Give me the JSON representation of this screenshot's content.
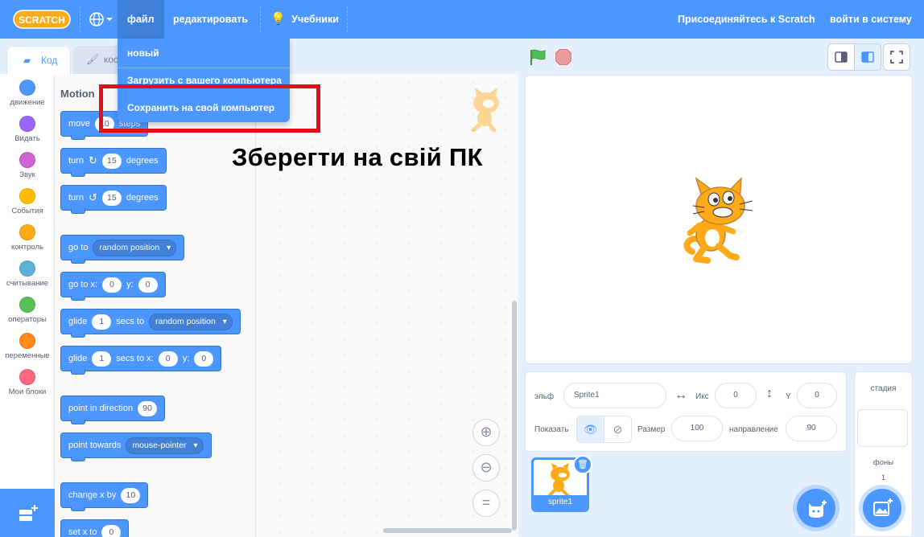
{
  "menubar": {
    "logo_text": "SCRATCH",
    "file": "файл",
    "edit": "редактировать",
    "tutorials": "Учебники",
    "join": "Присоединяйтесь к Scratch",
    "signin": "войти в систему"
  },
  "file_menu": {
    "items": [
      "новый",
      "Загрузить с вашего компьютера",
      "Сохранить на свой компьютер"
    ]
  },
  "annotation": "Зберегти на свій ПК",
  "tabs": {
    "code": "Код",
    "costumes": "кост"
  },
  "categories": [
    {
      "label": "движение",
      "color": "#4c97ff"
    },
    {
      "label": "Видать",
      "color": "#9966ff"
    },
    {
      "label": "Звук",
      "color": "#cf63cf"
    },
    {
      "label": "События",
      "color": "#ffbf00"
    },
    {
      "label": "контроль",
      "color": "#ffab19"
    },
    {
      "label": "считывание",
      "color": "#5cb1d6"
    },
    {
      "label": "операторы",
      "color": "#59c059"
    },
    {
      "label": "переменные",
      "color": "#ff8c1a"
    },
    {
      "label": "Мои блоки",
      "color": "#ff6680"
    }
  ],
  "palette": {
    "title": "Motion",
    "move": {
      "a": "move",
      "n": "10",
      "b": "steps"
    },
    "turn_right": {
      "a": "turn",
      "n": "15",
      "b": "degrees"
    },
    "turn_left": {
      "a": "turn",
      "n": "15",
      "b": "degrees"
    },
    "goto": {
      "a": "go to",
      "d": "random position"
    },
    "gotoxy": {
      "a": "go to x:",
      "x": "0",
      "b": "y:",
      "y": "0"
    },
    "glide_to": {
      "a": "glide",
      "n": "1",
      "b": "secs to",
      "d": "random position"
    },
    "glide_xy": {
      "a": "glide",
      "n": "1",
      "b": "secs to x:",
      "x": "0",
      "c": "y:",
      "y": "0"
    },
    "point_dir": {
      "a": "point in direction",
      "n": "90"
    },
    "point_towards": {
      "a": "point towards",
      "d": "mouse-pointer"
    },
    "change_x": {
      "a": "change x by",
      "n": "10"
    },
    "set_x": {
      "a": "set x to",
      "n": "0"
    }
  },
  "sprite_info": {
    "sprite_label": "эльф",
    "sprite_name": "Sprite1",
    "x_label": "Икс",
    "x_value": "0",
    "y_label": "Y",
    "y_value": "0",
    "show_label": "Показать",
    "size_label": "Размер",
    "size_value": "100",
    "direction_label": "направление",
    "direction_value": "90"
  },
  "sprites": [
    {
      "name": "sprite1"
    }
  ],
  "stage_pane": {
    "title": "стадия",
    "backdrops_label": "фоны",
    "backdrops_count": "1"
  }
}
